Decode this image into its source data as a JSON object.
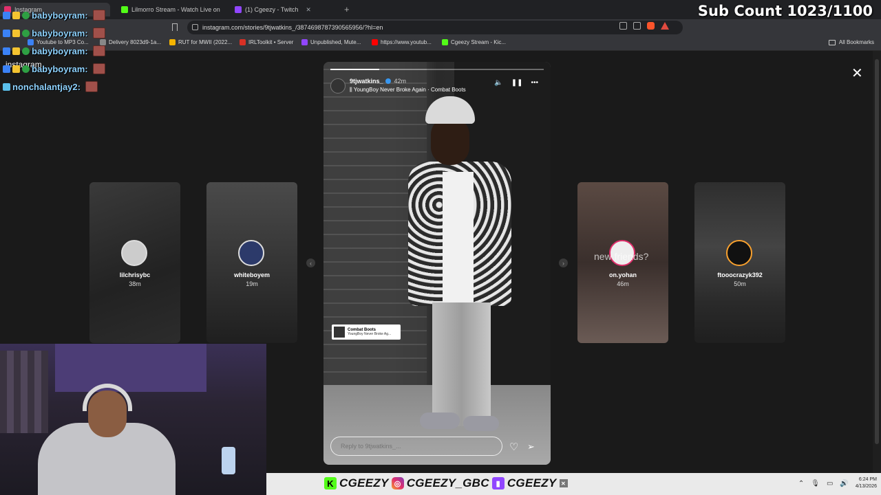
{
  "tabs": [
    {
      "label": "Instagram",
      "color": "#e1306c"
    },
    {
      "label": "Lilmorro Stream - Watch Live on",
      "color": "#53fc18"
    },
    {
      "label": "(1) Cgeezy - Twitch",
      "color": "#9146ff"
    }
  ],
  "overlay": {
    "sub_count": "Sub Count 1023/1100"
  },
  "address": {
    "url": "instagram.com/stories/9tjwatkins_/3874698787390565956/?hl=en"
  },
  "bookmarks": [
    {
      "label": "Youtube to MP3 Co...",
      "color": "#3b82f6"
    },
    {
      "label": "Delivery 8023d9-1a...",
      "color": "#888888"
    },
    {
      "label": "RUT for MWII (2022...",
      "color": "#f4b400"
    },
    {
      "label": "IRLToolkit • Server",
      "color": "#d93025"
    },
    {
      "label": "Unpublished, Mute...",
      "color": "#9146ff"
    },
    {
      "label": "https://www.youtub...",
      "color": "#ff0000"
    },
    {
      "label": "Cgeezy Stream - Kic...",
      "color": "#53fc18"
    }
  ],
  "all_bookmarks": "All Bookmarks",
  "chat": [
    {
      "user": "babyboyram:"
    },
    {
      "user": "babyboyram:"
    },
    {
      "user": "babyboyram:"
    },
    {
      "user": "babyboyram:"
    },
    {
      "user": "nonchalantjay2:"
    }
  ],
  "chat_overlay_text": "instagram",
  "stories_left": [
    {
      "name": "lilchrisybc",
      "time": "38m"
    },
    {
      "name": "whiteboyem",
      "time": "19m"
    }
  ],
  "stories_right": [
    {
      "name": "on.yohan",
      "time": "46m",
      "overlay": "new friends?"
    },
    {
      "name": "ftooocrazyk392",
      "time": "50m"
    }
  ],
  "story": {
    "username": "9tjwatkins_",
    "time": "42m",
    "music": "YoungBoy Never Broke Again · Combat Boots",
    "progress": 0.23,
    "sticker_title": "Combat Boots",
    "sticker_sub": "YoungBoy Never Broke Ag...",
    "reply_placeholder": "Reply to 9tjwatkins_..."
  },
  "taskbar": {
    "kick": "CGEEZY",
    "instagram": "CGEEZY_GBC",
    "twitch": "CGEEZY",
    "time": "6:24 PM",
    "date": "4/13/2026"
  }
}
